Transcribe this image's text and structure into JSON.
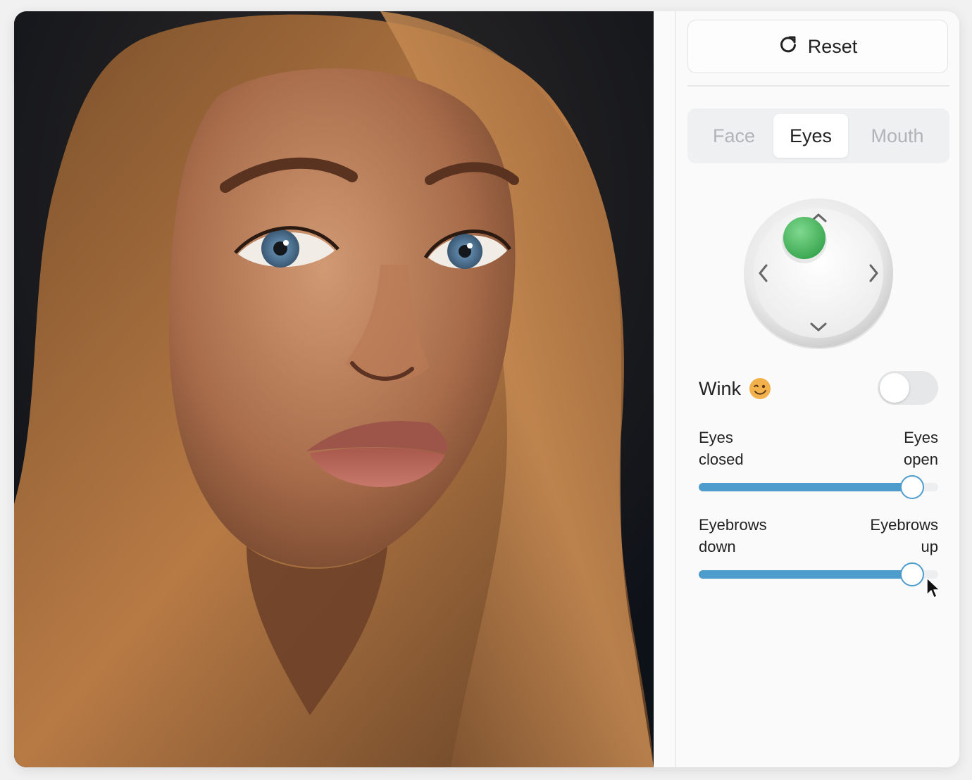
{
  "toolbar": {
    "reset_label": "Reset"
  },
  "tabs": [
    {
      "label": "Face",
      "active": false
    },
    {
      "label": "Eyes",
      "active": true
    },
    {
      "label": "Mouth",
      "active": false
    }
  ],
  "wink": {
    "label": "Wink",
    "emoji": "winking-face",
    "enabled": false
  },
  "sliders": [
    {
      "left_line1": "Eyes",
      "left_line2": "closed",
      "right_line1": "Eyes",
      "right_line2": "open",
      "value": 0.89
    },
    {
      "left_line1": "Eyebrows",
      "left_line2": "down",
      "right_line1": "Eyebrows",
      "right_line2": "up",
      "value": 0.89
    }
  ],
  "joystick": {
    "position": "up",
    "knob_color": "#57c26b"
  },
  "colors": {
    "accent": "#4d9ccc",
    "knob": "#57c26b"
  }
}
